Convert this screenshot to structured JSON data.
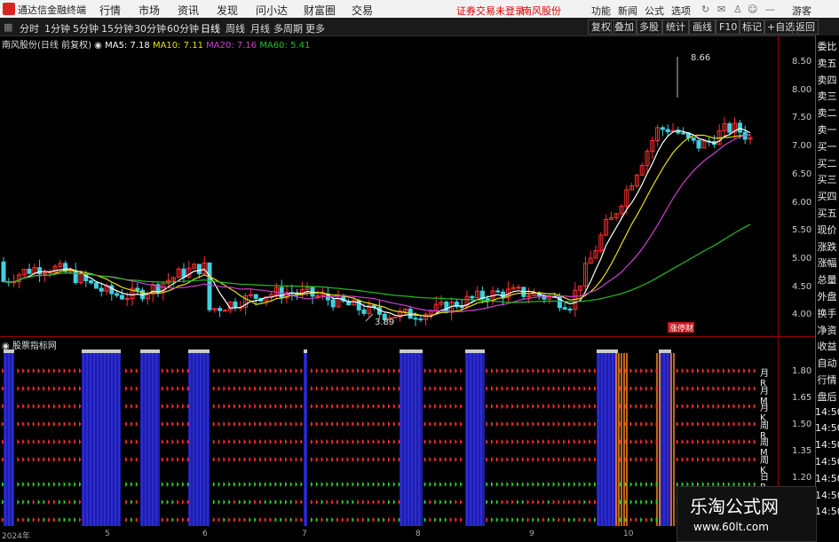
{
  "app_title": "通达信金融终端",
  "menu": [
    "行情",
    "市场",
    "资讯",
    "发现",
    "问小达",
    "财富圈",
    "交易"
  ],
  "status_login": "证券交易未登录",
  "status_stock": "南风股份",
  "right_menu": [
    "功能",
    "新闻",
    "公式",
    "选项"
  ],
  "guest": "游客",
  "periods": [
    "分时",
    "1分钟",
    "5分钟",
    "15分钟",
    "30分钟",
    "60分钟",
    "日线",
    "周线",
    "月线",
    "多周期",
    "更多"
  ],
  "active_period": "日线",
  "right_buttons": [
    "复权",
    "叠加",
    "多股",
    "统计",
    "画线",
    "F10",
    "标记",
    "+自选",
    "返回"
  ],
  "info": {
    "stock": "南风股份(日线 前复权)",
    "ma5": "MA5: 7.18",
    "ma10": "MA10: 7.11",
    "ma20": "MA20: 7.16",
    "ma60": "MA60: 5.41"
  },
  "price_labels": [
    "8.50",
    "8.00",
    "7.50",
    "7.00",
    "6.50",
    "6.00",
    "5.50",
    "5.00",
    "4.50",
    "4.00"
  ],
  "lower_labels": [
    "1.80",
    "1.65",
    "1.50",
    "1.35",
    "1.20"
  ],
  "high_mark": "8.66",
  "low_mark": "3.89",
  "event_tag": "涨停财",
  "lower_title": "股票指标网",
  "right_labels": [
    "月R",
    "月M",
    "月K",
    "周R",
    "周M",
    "周K",
    "日R"
  ],
  "side_panel": [
    "委比",
    "卖五",
    "卖四",
    "卖三",
    "卖二",
    "卖一",
    "买一",
    "买二",
    "买三",
    "买四",
    "买五",
    "现价",
    "涨跌",
    "涨幅",
    "总量",
    "外盘",
    "换手",
    "净资",
    "收益",
    "自动",
    "行情",
    "盘后",
    "14:50",
    "14:50",
    "14:50",
    "14:50",
    "14:50",
    "14:50",
    "14:50"
  ],
  "x_labels": [
    "2024年",
    "5",
    "6",
    "7",
    "8",
    "9",
    "10"
  ],
  "watermark": {
    "title": "乐淘公式网",
    "url": "www.60lt.com"
  },
  "colors": {
    "up": "#ff3030",
    "down": "#40d0e0",
    "ma5": "#ffffff",
    "ma10": "#e8e000",
    "ma20": "#d040d0",
    "ma60": "#20c020",
    "blue": "#1e1ea8",
    "orange": "#ff8c1a",
    "green": "#30d030"
  }
}
